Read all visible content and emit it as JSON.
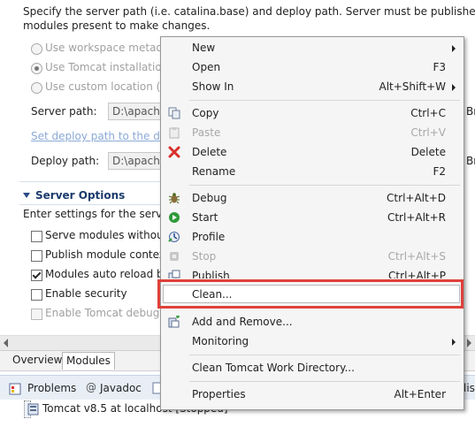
{
  "server_locations": {
    "description_line1": "Specify the server path (i.e. catalina.base) and deploy path. Server must be published wi",
    "description_line2": "modules present to make changes.",
    "options": [
      {
        "label": "Use workspace metad",
        "selected": false
      },
      {
        "label": "Use Tomcat installation",
        "selected": true
      },
      {
        "label": "Use custom location (c",
        "selected": false
      }
    ],
    "server_path_label": "Server path:",
    "server_path_value": "D:\\apache",
    "browse_label_1": "Br",
    "set_deploy_link": "Set deploy path to the de",
    "deploy_path_label": "Deploy path:",
    "deploy_path_value": "D:\\apach",
    "browse_label_2": "Br"
  },
  "server_options": {
    "title": "Server Options",
    "description": "Enter settings for the serve",
    "checkboxes": [
      {
        "label": "Serve modules without",
        "checked": false,
        "enabled": true
      },
      {
        "label": "Publish module contex",
        "checked": false,
        "enabled": true
      },
      {
        "label": "Modules auto reload b",
        "checked": true,
        "enabled": true
      },
      {
        "label": "Enable security",
        "checked": false,
        "enabled": true
      },
      {
        "label": "Enable Tomcat debug",
        "checked": false,
        "enabled": false
      }
    ]
  },
  "editor_tabs": [
    {
      "label": "Overview",
      "selected": false
    },
    {
      "label": "Modules",
      "selected": true
    }
  ],
  "views": {
    "problems": "Problems",
    "javadoc": "Javadoc",
    "truncated_right": "list"
  },
  "servers_list": [
    {
      "label": "Tomcat v8.5 at localhost  [Stopped]"
    }
  ],
  "context_menu": {
    "items": [
      {
        "label": "New",
        "accel": "",
        "submenu": true,
        "enabled": true,
        "icon": ""
      },
      {
        "label": "Open",
        "accel": "F3",
        "submenu": false,
        "enabled": true,
        "icon": ""
      },
      {
        "label": "Show In",
        "accel": "Alt+Shift+W",
        "submenu": true,
        "enabled": true,
        "icon": ""
      },
      {
        "label": "Copy",
        "accel": "Ctrl+C",
        "submenu": false,
        "enabled": true,
        "icon": "copy-icon"
      },
      {
        "label": "Paste",
        "accel": "Ctrl+V",
        "submenu": false,
        "enabled": false,
        "icon": "paste-icon"
      },
      {
        "label": "Delete",
        "accel": "Delete",
        "submenu": false,
        "enabled": true,
        "icon": "delete-icon"
      },
      {
        "label": "Rename",
        "accel": "F2",
        "submenu": false,
        "enabled": true,
        "icon": ""
      },
      {
        "label": "Debug",
        "accel": "Ctrl+Alt+D",
        "submenu": false,
        "enabled": true,
        "icon": "debug-icon"
      },
      {
        "label": "Start",
        "accel": "Ctrl+Alt+R",
        "submenu": false,
        "enabled": true,
        "icon": "start-icon"
      },
      {
        "label": "Profile",
        "accel": "",
        "submenu": false,
        "enabled": true,
        "icon": "profile-icon"
      },
      {
        "label": "Stop",
        "accel": "Ctrl+Alt+S",
        "submenu": false,
        "enabled": false,
        "icon": "stop-icon"
      },
      {
        "label": "Publish",
        "accel": "Ctrl+Alt+P",
        "submenu": false,
        "enabled": true,
        "icon": "publish-icon"
      },
      {
        "label": "Clean...",
        "accel": "",
        "submenu": false,
        "enabled": true,
        "icon": "",
        "highlighted": true
      },
      {
        "label": "Add and Remove...",
        "accel": "",
        "submenu": false,
        "enabled": true,
        "icon": "add-remove-icon"
      },
      {
        "label": "Monitoring",
        "accel": "",
        "submenu": true,
        "enabled": true,
        "icon": ""
      },
      {
        "label": "Clean Tomcat Work Directory...",
        "accel": "",
        "submenu": false,
        "enabled": true,
        "icon": ""
      },
      {
        "label": "Properties",
        "accel": "Alt+Enter",
        "submenu": false,
        "enabled": true,
        "icon": ""
      }
    ]
  },
  "colors": {
    "highlight_border": "#e0403a",
    "section_title": "#1b3a6b",
    "link": "#8aa9d6"
  }
}
